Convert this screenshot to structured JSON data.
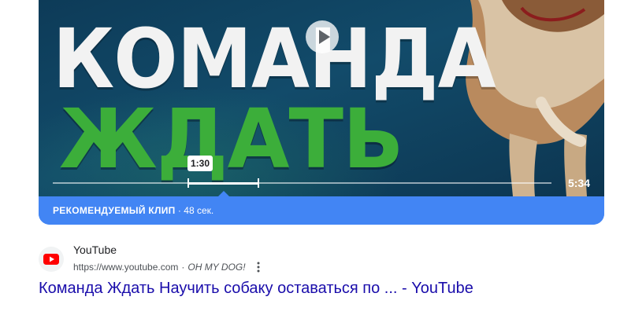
{
  "video": {
    "thumbnail_line1": "КОМАНДА",
    "thumbnail_line2": "ЖДАТЬ",
    "tooltip_time": "1:30",
    "duration": "5:34",
    "clip_start_fraction": 0.3,
    "clip_end_fraction": 0.44
  },
  "clip_bar": {
    "label": "РЕКОМЕНДУЕМЫЙ КЛИП",
    "separator": " · ",
    "length": "48 сек."
  },
  "result": {
    "site_name": "YouTube",
    "url": "https://www.youtube.com",
    "separator": "·",
    "channel": "OH MY DOG!",
    "title": "Команда Ждать Научить собаку оставаться по ... - YouTube"
  },
  "colors": {
    "accent_blue": "#4285f4",
    "link": "#1a0dab",
    "youtube_red": "#ff0000",
    "thumb_green": "#3cae3a"
  },
  "icons": {
    "play": "play-icon",
    "source": "youtube-icon",
    "more": "more-vert-icon"
  }
}
